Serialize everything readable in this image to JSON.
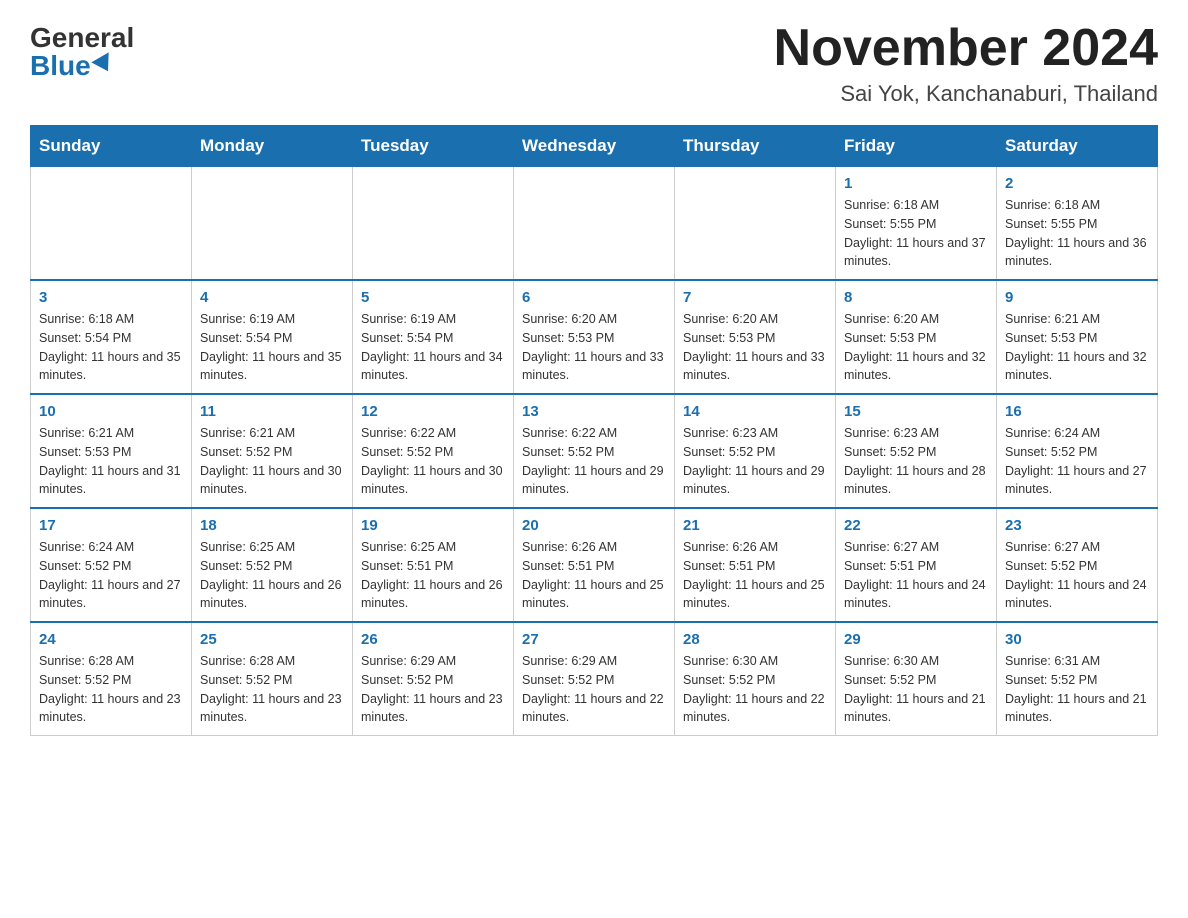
{
  "header": {
    "logo_general": "General",
    "logo_blue": "Blue",
    "title": "November 2024",
    "location": "Sai Yok, Kanchanaburi, Thailand"
  },
  "calendar": {
    "days_of_week": [
      "Sunday",
      "Monday",
      "Tuesday",
      "Wednesday",
      "Thursday",
      "Friday",
      "Saturday"
    ],
    "weeks": [
      [
        {
          "day": "",
          "info": ""
        },
        {
          "day": "",
          "info": ""
        },
        {
          "day": "",
          "info": ""
        },
        {
          "day": "",
          "info": ""
        },
        {
          "day": "",
          "info": ""
        },
        {
          "day": "1",
          "info": "Sunrise: 6:18 AM\nSunset: 5:55 PM\nDaylight: 11 hours and 37 minutes."
        },
        {
          "day": "2",
          "info": "Sunrise: 6:18 AM\nSunset: 5:55 PM\nDaylight: 11 hours and 36 minutes."
        }
      ],
      [
        {
          "day": "3",
          "info": "Sunrise: 6:18 AM\nSunset: 5:54 PM\nDaylight: 11 hours and 35 minutes."
        },
        {
          "day": "4",
          "info": "Sunrise: 6:19 AM\nSunset: 5:54 PM\nDaylight: 11 hours and 35 minutes."
        },
        {
          "day": "5",
          "info": "Sunrise: 6:19 AM\nSunset: 5:54 PM\nDaylight: 11 hours and 34 minutes."
        },
        {
          "day": "6",
          "info": "Sunrise: 6:20 AM\nSunset: 5:53 PM\nDaylight: 11 hours and 33 minutes."
        },
        {
          "day": "7",
          "info": "Sunrise: 6:20 AM\nSunset: 5:53 PM\nDaylight: 11 hours and 33 minutes."
        },
        {
          "day": "8",
          "info": "Sunrise: 6:20 AM\nSunset: 5:53 PM\nDaylight: 11 hours and 32 minutes."
        },
        {
          "day": "9",
          "info": "Sunrise: 6:21 AM\nSunset: 5:53 PM\nDaylight: 11 hours and 32 minutes."
        }
      ],
      [
        {
          "day": "10",
          "info": "Sunrise: 6:21 AM\nSunset: 5:53 PM\nDaylight: 11 hours and 31 minutes."
        },
        {
          "day": "11",
          "info": "Sunrise: 6:21 AM\nSunset: 5:52 PM\nDaylight: 11 hours and 30 minutes."
        },
        {
          "day": "12",
          "info": "Sunrise: 6:22 AM\nSunset: 5:52 PM\nDaylight: 11 hours and 30 minutes."
        },
        {
          "day": "13",
          "info": "Sunrise: 6:22 AM\nSunset: 5:52 PM\nDaylight: 11 hours and 29 minutes."
        },
        {
          "day": "14",
          "info": "Sunrise: 6:23 AM\nSunset: 5:52 PM\nDaylight: 11 hours and 29 minutes."
        },
        {
          "day": "15",
          "info": "Sunrise: 6:23 AM\nSunset: 5:52 PM\nDaylight: 11 hours and 28 minutes."
        },
        {
          "day": "16",
          "info": "Sunrise: 6:24 AM\nSunset: 5:52 PM\nDaylight: 11 hours and 27 minutes."
        }
      ],
      [
        {
          "day": "17",
          "info": "Sunrise: 6:24 AM\nSunset: 5:52 PM\nDaylight: 11 hours and 27 minutes."
        },
        {
          "day": "18",
          "info": "Sunrise: 6:25 AM\nSunset: 5:52 PM\nDaylight: 11 hours and 26 minutes."
        },
        {
          "day": "19",
          "info": "Sunrise: 6:25 AM\nSunset: 5:51 PM\nDaylight: 11 hours and 26 minutes."
        },
        {
          "day": "20",
          "info": "Sunrise: 6:26 AM\nSunset: 5:51 PM\nDaylight: 11 hours and 25 minutes."
        },
        {
          "day": "21",
          "info": "Sunrise: 6:26 AM\nSunset: 5:51 PM\nDaylight: 11 hours and 25 minutes."
        },
        {
          "day": "22",
          "info": "Sunrise: 6:27 AM\nSunset: 5:51 PM\nDaylight: 11 hours and 24 minutes."
        },
        {
          "day": "23",
          "info": "Sunrise: 6:27 AM\nSunset: 5:52 PM\nDaylight: 11 hours and 24 minutes."
        }
      ],
      [
        {
          "day": "24",
          "info": "Sunrise: 6:28 AM\nSunset: 5:52 PM\nDaylight: 11 hours and 23 minutes."
        },
        {
          "day": "25",
          "info": "Sunrise: 6:28 AM\nSunset: 5:52 PM\nDaylight: 11 hours and 23 minutes."
        },
        {
          "day": "26",
          "info": "Sunrise: 6:29 AM\nSunset: 5:52 PM\nDaylight: 11 hours and 23 minutes."
        },
        {
          "day": "27",
          "info": "Sunrise: 6:29 AM\nSunset: 5:52 PM\nDaylight: 11 hours and 22 minutes."
        },
        {
          "day": "28",
          "info": "Sunrise: 6:30 AM\nSunset: 5:52 PM\nDaylight: 11 hours and 22 minutes."
        },
        {
          "day": "29",
          "info": "Sunrise: 6:30 AM\nSunset: 5:52 PM\nDaylight: 11 hours and 21 minutes."
        },
        {
          "day": "30",
          "info": "Sunrise: 6:31 AM\nSunset: 5:52 PM\nDaylight: 11 hours and 21 minutes."
        }
      ]
    ]
  }
}
